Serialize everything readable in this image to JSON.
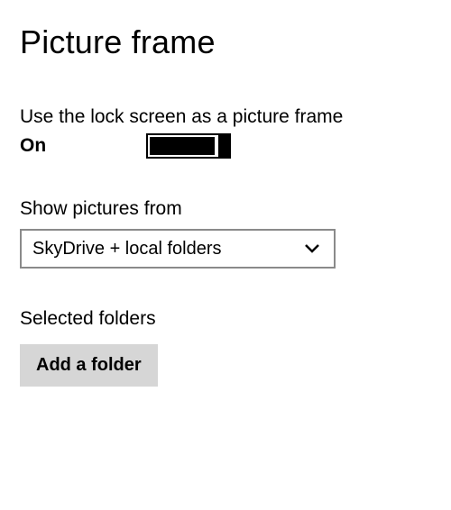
{
  "header": {
    "title": "Picture frame"
  },
  "lockscreen_frame": {
    "label": "Use the lock screen as a picture frame",
    "state_text": "On"
  },
  "show_pictures": {
    "label": "Show pictures from",
    "selected": "SkyDrive + local folders"
  },
  "selected_folders": {
    "label": "Selected folders",
    "add_button_label": "Add a folder"
  }
}
